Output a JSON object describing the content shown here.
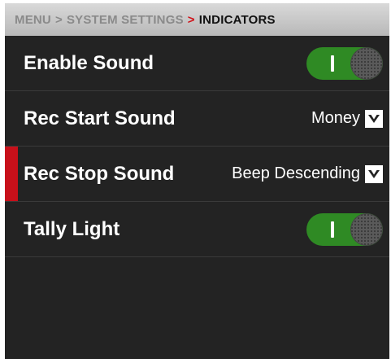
{
  "breadcrumb": {
    "menu": "MENU",
    "sep1": ">",
    "system_settings": "SYSTEM SETTINGS",
    "sep2": ">",
    "current": "INDICATORS"
  },
  "rows": [
    {
      "label": "Enable Sound",
      "type": "toggle",
      "value": "on"
    },
    {
      "label": "Rec Start Sound",
      "type": "select",
      "value": "Money"
    },
    {
      "label": "Rec Stop Sound",
      "type": "select",
      "value": "Beep Descending",
      "selected": true
    },
    {
      "label": "Tally Light",
      "type": "toggle",
      "value": "on"
    }
  ],
  "colors": {
    "background": "#232323",
    "toggle_on": "#2f8a24",
    "selection_accent": "#c8101a",
    "breadcrumb_arrow_active": "#d0131a"
  }
}
